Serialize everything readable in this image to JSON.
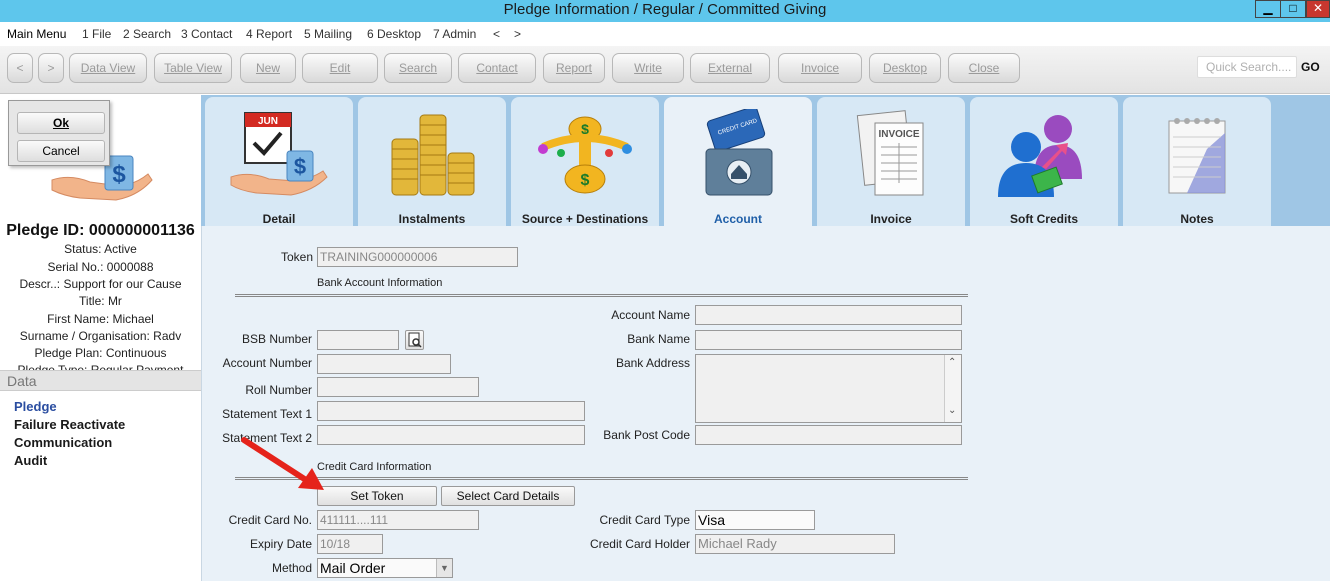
{
  "window": {
    "title": "Pledge Information / Regular / Committed Giving"
  },
  "menu": [
    "Main Menu",
    "1 File",
    "2 Search",
    "3 Contact",
    "4 Report",
    "5 Mailing",
    "6 Desktop",
    "7 Admin",
    "<",
    ">"
  ],
  "toolbar": {
    "prev": "<",
    "next": ">",
    "buttons": [
      "Data View",
      "Table View",
      "New",
      "Edit",
      "Search",
      "Contact",
      "Report",
      "Write",
      "External",
      "Invoice",
      "Desktop",
      "Close"
    ],
    "quick_search_placeholder": "Quick Search....",
    "go": "GO"
  },
  "dialog": {
    "ok": "Ok",
    "cancel": "Cancel"
  },
  "pledge": {
    "id_line": "Pledge ID: 000000001136",
    "status": "Status: Active",
    "serial": "Serial No.: 0000088",
    "descr": "Descr..: Support for our Cause",
    "title": "Title: Mr",
    "first_name": "First Name: Michael",
    "surname": "Surname / Organisation: Radv",
    "plan": "Pledge Plan: Continuous",
    "type": "Pledge Type: Regular Payment"
  },
  "data_section": {
    "header": "Data",
    "links": [
      "Pledge",
      "Failure Reactivate",
      "Communication",
      "Audit"
    ]
  },
  "tabs": [
    "Detail",
    "Instalments",
    "Source + Destinations",
    "Account",
    "Invoice",
    "Soft Credits",
    "Notes"
  ],
  "active_tab": "Account",
  "icon_texts": {
    "calendar_month": "JUN",
    "invoice_label": "INVOICE",
    "card_label": "CREDIT CARD"
  },
  "form": {
    "token_label": "Token",
    "token_value": "TRAINING000000006",
    "bank_section": "Bank Account Information",
    "bsb_label": "BSB Number",
    "bsb_value": "",
    "account_number_label": "Account Number",
    "account_number_value": "",
    "roll_number_label": "Roll Number",
    "roll_number_value": "",
    "statement1_label": "Statement Text 1",
    "statement1_value": "",
    "statement2_label": "Statement Text 2",
    "statement2_value": "",
    "account_name_label": "Account Name",
    "account_name_value": "",
    "bank_name_label": "Bank Name",
    "bank_name_value": "",
    "bank_address_label": "Bank Address",
    "bank_address_value": "",
    "bank_post_code_label": "Bank Post Code",
    "bank_post_code_value": "",
    "cc_section": "Credit Card Information",
    "set_token": "Set Token",
    "select_card": "Select Card Details",
    "cc_no_label": "Credit Card No.",
    "cc_no_value": "411111....111",
    "expiry_label": "Expiry Date",
    "expiry_value": "10/18",
    "method_label": "Method",
    "method_value": "Mail Order",
    "cc_type_label": "Credit Card Type",
    "cc_type_value": "Visa",
    "cc_holder_label": "Credit Card Holder",
    "cc_holder_value": "Michael Rady"
  },
  "colors": {
    "titlebar": "#5ec6ec",
    "tab_strip": "#9fc6e5",
    "tab": "#d7e8f5",
    "content": "#e9f1f8",
    "active_tab_text": "#1f5fa8",
    "arrow": "#e5231b"
  }
}
